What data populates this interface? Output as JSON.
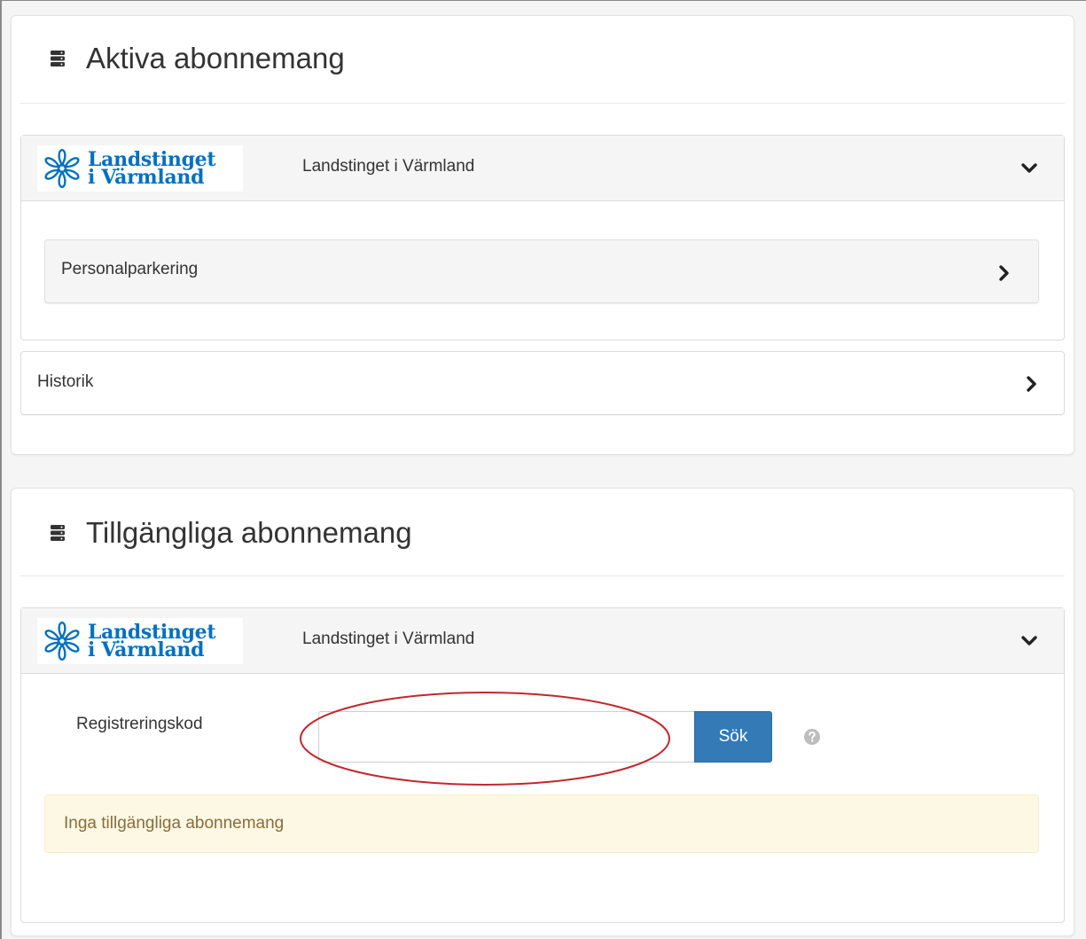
{
  "active_panel": {
    "title": "Aktiva abonnemang",
    "organization": {
      "logo_line1": "Landstinget",
      "logo_line2": "i Värmland",
      "name": "Landstinget i Värmland"
    },
    "items": [
      {
        "label": "Personalparkering"
      }
    ],
    "history_label": "Historik"
  },
  "available_panel": {
    "title": "Tillgängliga abonnemang",
    "organization": {
      "logo_line1": "Landstinget",
      "logo_line2": "i Värmland",
      "name": "Landstinget i Värmland"
    },
    "registration": {
      "label": "Registreringskod",
      "value": "",
      "search_label": "Sök"
    },
    "alert_text": "Inga tillgängliga abonnemang"
  },
  "colors": {
    "primary_button": "#337ab7",
    "logo_blue": "#0070c0",
    "warning_bg": "#fcf8e3",
    "warning_text": "#8a6d3b",
    "annotation_ellipse": "#c0282d"
  },
  "icons": {
    "panel_heading": "server-stack-icon",
    "expand": "chevron-down-icon",
    "navigate": "chevron-right-icon",
    "help": "question-circle-icon"
  }
}
